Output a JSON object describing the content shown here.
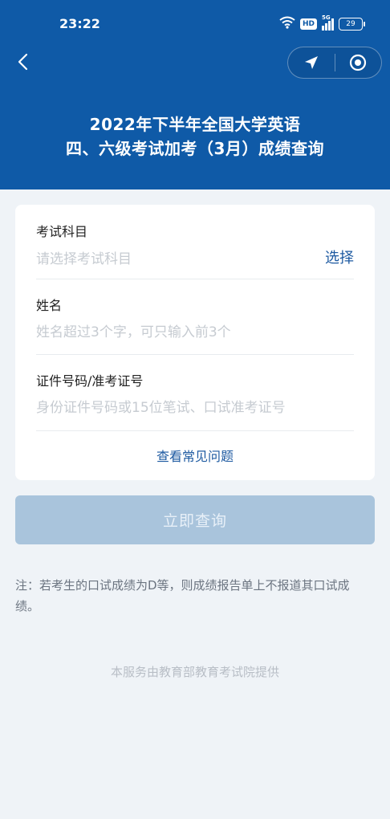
{
  "status_bar": {
    "time": "23:22",
    "hd_label": "HD",
    "network_label": "5G",
    "battery": "29"
  },
  "nav": {
    "back_icon": "chevron-left-icon",
    "capsule_icons": [
      "location-arrow-icon",
      "target-circle-icon"
    ]
  },
  "header": {
    "title_line1": "2022年下半年全国大学英语",
    "title_line2": "四、六级考试加考（3月）成绩查询"
  },
  "form": {
    "subject": {
      "label": "考试科目",
      "placeholder": "请选择考试科目",
      "action": "选择"
    },
    "name": {
      "label": "姓名",
      "placeholder": "姓名超过3个字，可只输入前3个"
    },
    "id_number": {
      "label": "证件号码/准考证号",
      "placeholder": "身份证件号码或15位笔试、口试准考证号"
    },
    "faq_link": "查看常见问题"
  },
  "submit_label": "立即查询",
  "note": "注：若考生的口试成绩为D等，则成绩报告单上不报道其口试成绩。",
  "footer": "本服务由教育部教育考试院提供",
  "colors": {
    "header_bg": "#0f5aa7",
    "link": "#1e5aa1",
    "button_disabled": "#a9c4dc",
    "page_bg": "#eff3f7"
  }
}
